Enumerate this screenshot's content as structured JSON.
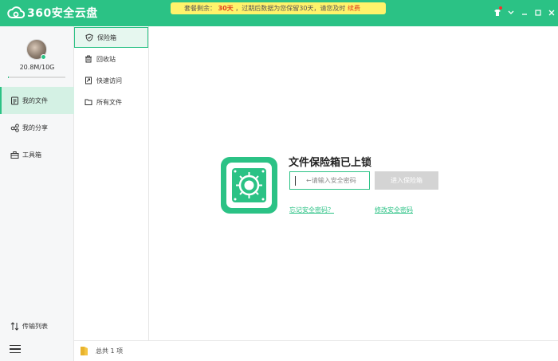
{
  "app": {
    "logo_text": "360安全云盘"
  },
  "notice": {
    "prefix": "套餐剩余：",
    "days": "30天",
    "middle": "，过期后数据为您保留30天，请您及时",
    "renew": "续费"
  },
  "user": {
    "quota": "20.8M/10G",
    "quota_used_fraction": 0.002
  },
  "nav": {
    "items": [
      {
        "label": "我的文件",
        "icon": "file-icon"
      },
      {
        "label": "我的分享",
        "icon": "share-icon"
      },
      {
        "label": "工具箱",
        "icon": "toolbox-icon"
      }
    ],
    "transfer_label": "传输列表"
  },
  "subnav": {
    "items": [
      {
        "label": "保险箱",
        "icon": "shield-icon"
      },
      {
        "label": "回收站",
        "icon": "trash-icon"
      },
      {
        "label": "快速访问",
        "icon": "quick-access-icon"
      },
      {
        "label": "所有文件",
        "icon": "folder-icon"
      }
    ]
  },
  "vault": {
    "title": "文件保险箱已上锁",
    "password_placeholder": "←请输入安全密码",
    "enter_label": "进入保险箱",
    "forgot_label": "忘记安全密码？",
    "change_label": "修改安全密码"
  },
  "status": {
    "total": "总共 1 项"
  },
  "colors": {
    "accent": "#2bc285",
    "notice_bg": "#fff36b",
    "alert": "#e03a1e"
  }
}
